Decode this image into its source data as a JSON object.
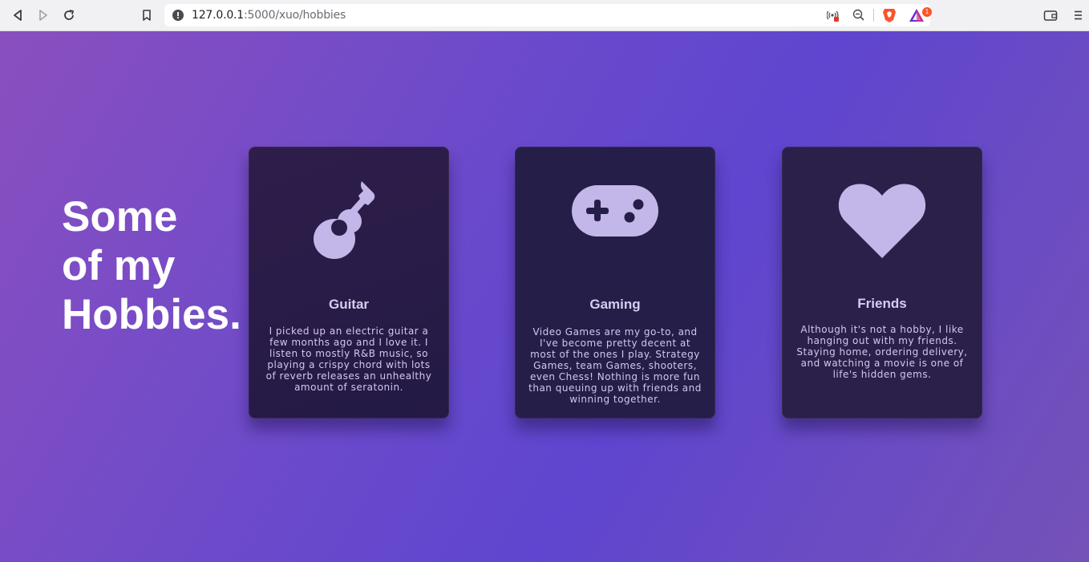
{
  "browser": {
    "url_host": "127.0.0.1",
    "url_path": ":5000/xuo/hobbies",
    "notification_count": "1"
  },
  "page": {
    "headline_lines": [
      "Some",
      "of my",
      "Hobbies."
    ],
    "cards": [
      {
        "icon": "guitar-icon",
        "title": "Guitar",
        "text": "I picked up an electric guitar a few months ago and I love it. I listen to mostly R&B music, so playing a crispy chord with lots of reverb releases an unhealthy amount of seratonin."
      },
      {
        "icon": "gamepad-icon",
        "title": "Gaming",
        "text": "Video Games are my go-to, and I've become pretty decent at most of the ones I play. Strategy Games, team Games, shooters, even Chess! Nothing is more fun than queuing up with friends and winning together."
      },
      {
        "icon": "heart-icon",
        "title": "Friends",
        "text": "Although it's not a hobby, I like hanging out with my friends. Staying home, ordering delivery, and watching a movie is one of life's hidden gems."
      }
    ]
  },
  "colors": {
    "icon_fill": "#c3b6e8",
    "card_bg": "#2a1f4c",
    "gradient_start": "#8a4fbf",
    "gradient_end": "#7552b8"
  }
}
